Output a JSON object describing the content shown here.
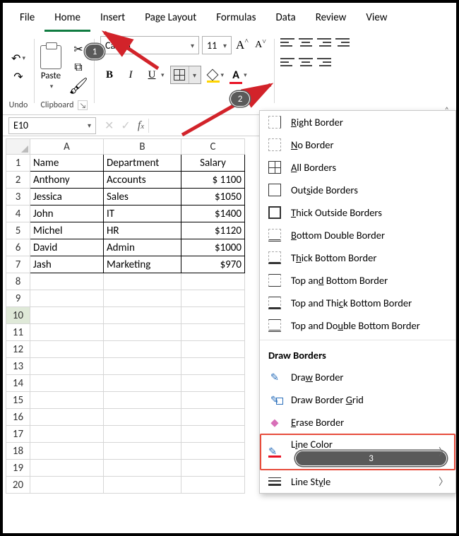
{
  "tabs": [
    "File",
    "Home",
    "Insert",
    "Page Layout",
    "Formulas",
    "Data",
    "Review",
    "View"
  ],
  "active_tab": "Home",
  "ribbon": {
    "undo_label": "Undo",
    "clipboard_label": "Clipboard",
    "paste_label": "Paste",
    "font_name": "Calibri",
    "font_size": "11",
    "bold": "B",
    "italic": "I",
    "underline": "U"
  },
  "namebox": "E10",
  "columns": [
    "A",
    "B",
    "C"
  ],
  "rows": [
    {
      "n": "1",
      "a": "Name",
      "b": "Department",
      "c": "Salary",
      "c_align": "center"
    },
    {
      "n": "2",
      "a": "Anthony",
      "b": "Accounts",
      "c": "$ 1100"
    },
    {
      "n": "3",
      "a": "Jessica",
      "b": "Sales",
      "c": "$1050"
    },
    {
      "n": "4",
      "a": "John",
      "b": "IT",
      "c": "$1400"
    },
    {
      "n": "5",
      "a": "Michel",
      "b": "HR",
      "c": "$1120"
    },
    {
      "n": "6",
      "a": "David",
      "b": "Admin",
      "c": "$1000"
    },
    {
      "n": "7",
      "a": "Jash",
      "b": "Marketing",
      "c": "$970"
    }
  ],
  "empty_rows": [
    "8",
    "9",
    "10",
    "11",
    "12",
    "13",
    "14",
    "15",
    "16",
    "17",
    "18",
    "19",
    "20"
  ],
  "selected_row": "10",
  "menu": {
    "items_top": [
      {
        "icon": "right",
        "label": "<u>R</u>ight Border"
      },
      {
        "icon": "none",
        "label": "<u>N</u>o Border"
      },
      {
        "icon": "all",
        "label": "<u>A</u>ll Borders"
      },
      {
        "icon": "outside",
        "label": "Out<u>s</u>ide Borders"
      },
      {
        "icon": "thick",
        "label": "<u>T</u>hick Outside Borders"
      },
      {
        "icon": "botdbl",
        "label": "<u>B</u>ottom Double Border"
      },
      {
        "icon": "botthk",
        "label": "T<u>h</u>ick Bottom Border"
      },
      {
        "icon": "topbot",
        "label": "Top an<u>d</u> Bottom Border"
      },
      {
        "icon": "topbotthk",
        "label": "Top and Thi<u>c</u>k Bottom Border"
      },
      {
        "icon": "topbotdbl",
        "label": "Top and Do<u>u</u>ble Bottom Border"
      }
    ],
    "section": "Draw Borders",
    "items_bottom": [
      {
        "icon": "pencil",
        "label": "Dra<u>w</u> Border"
      },
      {
        "icon": "pencilgrid",
        "label": "Draw Border <u>G</u>rid"
      },
      {
        "icon": "eraser",
        "label": "<u>E</u>rase Border"
      },
      {
        "icon": "linecolor",
        "label": "L<u>i</u>ne Color",
        "sub": true,
        "hl": true
      },
      {
        "icon": "linestyle",
        "label": "Line St<u>y</u>le",
        "sub": true
      }
    ]
  },
  "callouts": {
    "c1": "1",
    "c2": "2",
    "c3": "3"
  }
}
